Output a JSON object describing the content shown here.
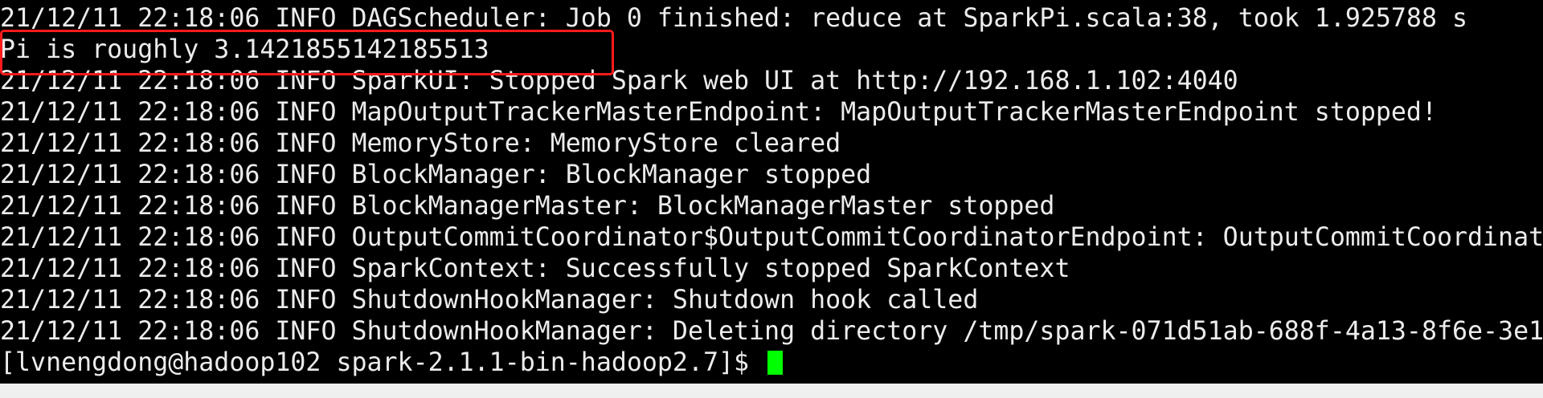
{
  "terminal": {
    "lines": [
      "21/12/11 22:18:06 INFO DAGScheduler: Job 0 finished: reduce at SparkPi.scala:38, took 1.925788 s",
      "Pi is roughly 3.1421855142185513",
      "21/12/11 22:18:06 INFO SparkUI: Stopped Spark web UI at http://192.168.1.102:4040",
      "21/12/11 22:18:06 INFO MapOutputTrackerMasterEndpoint: MapOutputTrackerMasterEndpoint stopped!",
      "21/12/11 22:18:06 INFO MemoryStore: MemoryStore cleared",
      "21/12/11 22:18:06 INFO BlockManager: BlockManager stopped",
      "21/12/11 22:18:06 INFO BlockManagerMaster: BlockManagerMaster stopped",
      "21/12/11 22:18:06 INFO OutputCommitCoordinator$OutputCommitCoordinatorEndpoint: OutputCommitCoordinat",
      "21/12/11 22:18:06 INFO SparkContext: Successfully stopped SparkContext",
      "21/12/11 22:18:06 INFO ShutdownHookManager: Shutdown hook called",
      "21/12/11 22:18:06 INFO ShutdownHookManager: Deleting directory /tmp/spark-071d51ab-688f-4a13-8f6e-3e1"
    ],
    "prompt": "[lvnengdong@hadoop102 spark-2.1.1-bin-hadoop2.7]$ ",
    "highlighted_line_index": 1
  },
  "colors": {
    "background": "#000000",
    "text": "#ececec",
    "cursor": "#00ff00",
    "highlight_border": "#ff1a1a"
  }
}
